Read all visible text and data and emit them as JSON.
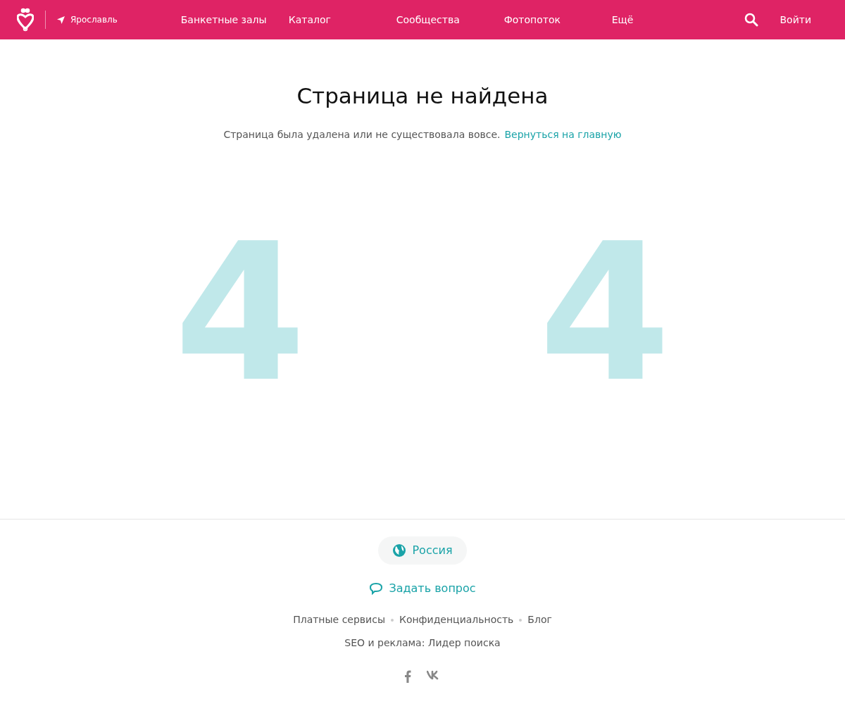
{
  "header": {
    "city": "Ярославль",
    "nav": [
      {
        "label": "Банкетные залы"
      },
      {
        "label": "Каталог"
      },
      {
        "label": "Сообщества"
      },
      {
        "label": "Фотопоток"
      },
      {
        "label": "Ещё"
      }
    ],
    "login": "Войти"
  },
  "main": {
    "title": "Страница не найдена",
    "message": "Страница была удалена или не существовала вовсе.",
    "home_link": "Вернуться на главную",
    "digits": [
      "4",
      "4"
    ]
  },
  "footer": {
    "country": "Россия",
    "ask": "Задать вопрос",
    "links": [
      "Платные сервисы",
      "Конфиденциальность",
      "Блог"
    ],
    "seo": "SEO и реклама: Лидер поиска"
  }
}
